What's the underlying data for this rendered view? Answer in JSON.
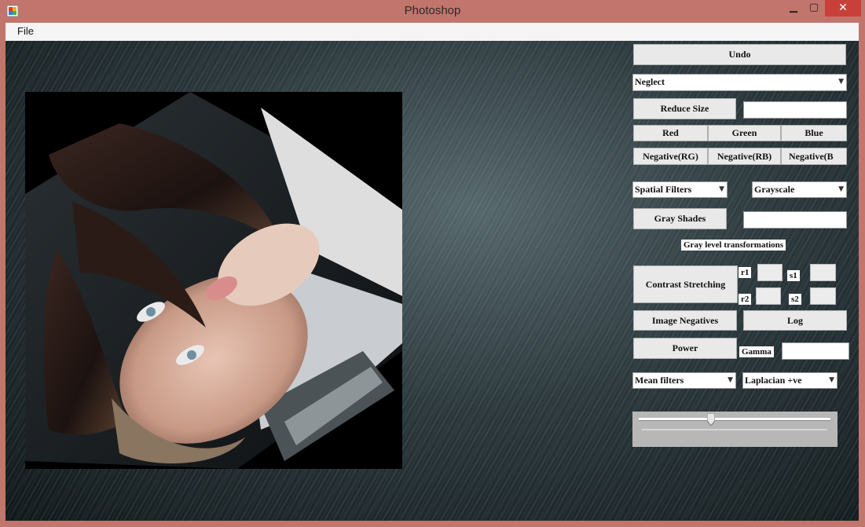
{
  "window": {
    "title": "Photoshop",
    "minimize": "▁",
    "maximize": "▢",
    "close": "✕"
  },
  "menu": {
    "file": "File"
  },
  "controls": {
    "undo": "Undo",
    "neglect_select": "Neglect",
    "reduce_size": "Reduce Size",
    "reduce_size_value": "",
    "red": "Red",
    "green": "Green",
    "blue": "Blue",
    "neg_rg": "Negative(RG)",
    "neg_rb": "Negative(RB)",
    "neg_b": "Negative(B",
    "spatial_filters_select": "Spatial Filters",
    "grayscale_select": "Grayscale",
    "gray_shades": "Gray Shades",
    "gray_shades_value": "",
    "gray_level_label": "Gray level transformations",
    "contrast_stretching": "Contrast Stretching",
    "r1_label": "r1",
    "s1_label": "s1",
    "r2_label": "r2",
    "s2_label": "s2",
    "image_negatives": "Image Negatives",
    "log": "Log",
    "power": "Power",
    "gamma_label": "Gamma",
    "gamma_value": "",
    "mean_filters_select": "Mean filters",
    "laplacian_select": "Laplacian +ve"
  },
  "slider": {
    "value_fraction": 0.37
  },
  "icons": {
    "dropdown": "chevron-down-icon",
    "app": "app-icon"
  }
}
